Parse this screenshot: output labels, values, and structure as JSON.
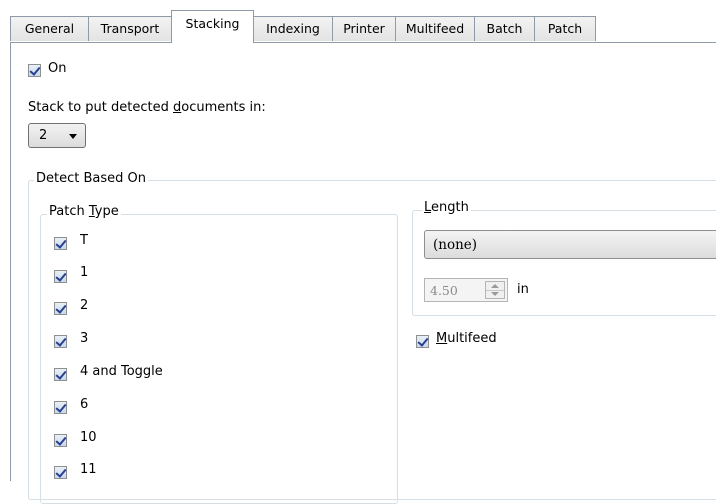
{
  "tabs": [
    {
      "label": "General"
    },
    {
      "label": "Transport"
    },
    {
      "label": "Stacking",
      "active": true
    },
    {
      "label": "Indexing"
    },
    {
      "label": "Printer"
    },
    {
      "label": "Multifeed"
    },
    {
      "label": "Batch"
    },
    {
      "label": "Patch"
    }
  ],
  "on_checkbox": {
    "label": "On",
    "checked": true
  },
  "stack": {
    "label_before": "Stack to put detected ",
    "label_underline": "d",
    "label_after": "ocuments in:",
    "value": "2"
  },
  "detect_group": {
    "title": "Detect Based On"
  },
  "patch_type": {
    "title_before": "Patch ",
    "title_underline": "T",
    "title_after": "ype",
    "items": [
      {
        "label": "T",
        "checked": true
      },
      {
        "label": "1",
        "checked": true
      },
      {
        "label": "2",
        "checked": true
      },
      {
        "label": "3",
        "checked": true
      },
      {
        "label": "4 and Toggle",
        "checked": true
      },
      {
        "label": "6",
        "checked": true
      },
      {
        "label": "10",
        "checked": true
      },
      {
        "label": "11",
        "checked": true
      }
    ]
  },
  "length": {
    "title_underline": "L",
    "title_after": "ength",
    "dropdown_value": "(none)",
    "spin_value": "4.50",
    "unit": "in"
  },
  "multifeed": {
    "label_underline": "M",
    "label_after": "ultifeed",
    "checked": true
  }
}
